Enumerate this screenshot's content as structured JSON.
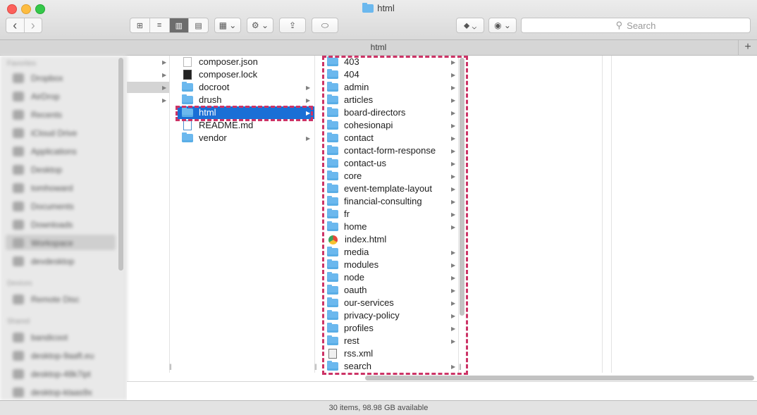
{
  "window": {
    "title": "html"
  },
  "toolbar": {
    "back_label": "‹",
    "forward_label": "›",
    "view_modes": [
      "⊞",
      "≡",
      "▥",
      "▤"
    ],
    "arrange_label": "▦ ⌄",
    "action_label": "⚙ ⌄",
    "share_label": "⇪",
    "tag_label": "⬭",
    "dropbox_label": "⬥ ⌄",
    "eye_label": "◉ ⌄",
    "search_placeholder": "Search"
  },
  "pathbar": {
    "title": "html",
    "plus_label": "+"
  },
  "sidebar": {
    "favorites_header": "Favorites",
    "favorites": [
      "Dropbox",
      "AirDrop",
      "Recents",
      "iCloud Drive",
      "Applications",
      "Desktop",
      "tomhoward",
      "Documents",
      "Downloads",
      "Workspace",
      "devdesktop"
    ],
    "devices_header": "Devices",
    "devices": [
      "Remote Disc"
    ],
    "shared_header": "Shared",
    "shared": [
      "bandicoot",
      "desktop-9aaft.eu",
      "desktop-48k7ipt",
      "desktop-klaas9x"
    ]
  },
  "column2": [
    {
      "name": "composer.json",
      "kind": "file"
    },
    {
      "name": "composer.lock",
      "kind": "dark"
    },
    {
      "name": "docroot",
      "kind": "folder"
    },
    {
      "name": "drush",
      "kind": "folder"
    },
    {
      "name": "html",
      "kind": "folder",
      "selected": true
    },
    {
      "name": "README.md",
      "kind": "md"
    },
    {
      "name": "vendor",
      "kind": "folder"
    }
  ],
  "column3": [
    {
      "name": "403",
      "kind": "folder"
    },
    {
      "name": "404",
      "kind": "folder"
    },
    {
      "name": "admin",
      "kind": "folder"
    },
    {
      "name": "articles",
      "kind": "folder"
    },
    {
      "name": "board-directors",
      "kind": "folder"
    },
    {
      "name": "cohesionapi",
      "kind": "folder"
    },
    {
      "name": "contact",
      "kind": "folder"
    },
    {
      "name": "contact-form-response",
      "kind": "folder"
    },
    {
      "name": "contact-us",
      "kind": "folder"
    },
    {
      "name": "core",
      "kind": "folder"
    },
    {
      "name": "event-template-layout",
      "kind": "folder"
    },
    {
      "name": "financial-consulting",
      "kind": "folder"
    },
    {
      "name": "fr",
      "kind": "folder"
    },
    {
      "name": "home",
      "kind": "folder"
    },
    {
      "name": "index.html",
      "kind": "web"
    },
    {
      "name": "media",
      "kind": "folder"
    },
    {
      "name": "modules",
      "kind": "folder"
    },
    {
      "name": "node",
      "kind": "folder"
    },
    {
      "name": "oauth",
      "kind": "folder"
    },
    {
      "name": "our-services",
      "kind": "folder"
    },
    {
      "name": "privacy-policy",
      "kind": "folder"
    },
    {
      "name": "profiles",
      "kind": "folder"
    },
    {
      "name": "rest",
      "kind": "folder"
    },
    {
      "name": "rss.xml",
      "kind": "xml"
    },
    {
      "name": "search",
      "kind": "folder"
    }
  ],
  "status": {
    "text": "30 items, 98.98 GB available"
  },
  "colors": {
    "selection": "#1a6fd6",
    "highlight_dash": "#cc3366",
    "folder": "#6bb8ee"
  }
}
